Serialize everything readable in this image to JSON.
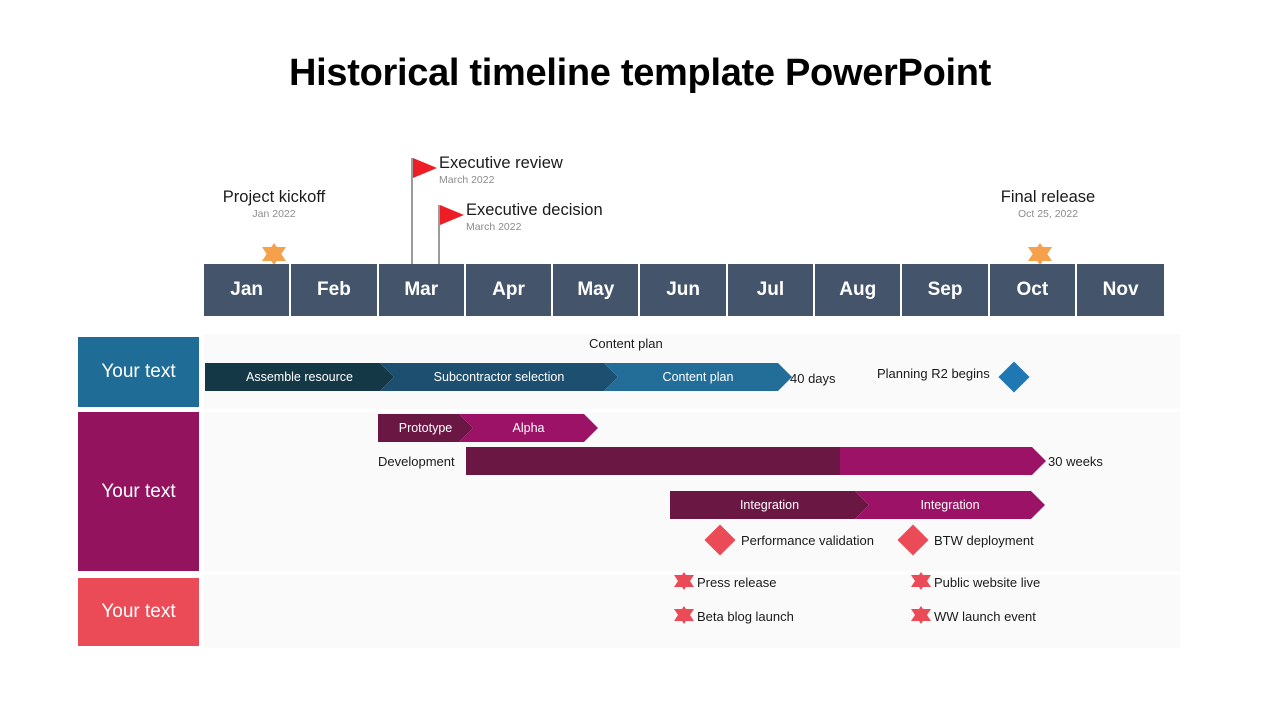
{
  "title": "Historical timeline template PowerPoint",
  "colors": {
    "axis": "#44546a",
    "lane_blue": "#1f6d96",
    "lane_magenta": "#93135e",
    "lane_red": "#ea4b57",
    "chevron_blue_dark": "#153847",
    "chevron_blue_mid": "#1d5070",
    "chevron_blue_light": "#226e99",
    "chevron_plum_dark": "#6b1744",
    "chevron_magenta": "#9c1266",
    "diamond_blue": "#1f77b4",
    "diamond_red": "#ea4b57",
    "star_orange": "#f5a04a",
    "star_red": "#ea4b57",
    "flag_red": "#ee1c25"
  },
  "axis": {
    "months": [
      "Jan",
      "Feb",
      "Mar",
      "Apr",
      "May",
      "Jun",
      "Jul",
      "Aug",
      "Sep",
      "Oct",
      "Nov"
    ]
  },
  "callouts": [
    {
      "name": "project-kickoff",
      "title": "Project kickoff",
      "date": "Jan 2022",
      "marker": "star",
      "marker_color": "star_orange"
    },
    {
      "name": "executive-review",
      "title": "Executive review",
      "date": "March 2022",
      "marker": "flag",
      "marker_color": "flag_red"
    },
    {
      "name": "executive-decision",
      "title": "Executive decision",
      "date": "March 2022",
      "marker": "flag",
      "marker_color": "flag_red"
    },
    {
      "name": "final-release",
      "title": "Final release",
      "date": "Oct 25, 2022",
      "marker": "star",
      "marker_color": "star_orange"
    }
  ],
  "lanes": [
    {
      "name": "lane-1",
      "label": "Your text",
      "color": "lane_blue",
      "top_caption": "Content  plan",
      "chevrons": [
        {
          "label": "Assemble resource",
          "color": "chevron_blue_dark"
        },
        {
          "label": "Subcontractor  selection",
          "color": "chevron_blue_mid"
        },
        {
          "label": "Content  plan",
          "color": "chevron_blue_light"
        }
      ],
      "duration": "40 days",
      "milestones": [
        {
          "label": "Planning  R2 begins",
          "shape": "diamond",
          "color": "diamond_blue"
        }
      ]
    },
    {
      "name": "lane-2",
      "label": "Your text",
      "color": "lane_magenta",
      "chevrons_top": [
        {
          "label": "Prototype",
          "color": "chevron_plum_dark"
        },
        {
          "label": "Alpha",
          "color": "chevron_magenta"
        }
      ],
      "development_caption": "Development",
      "development_duration": "30 weeks",
      "chevrons_mid": [
        {
          "label": "Integration",
          "color": "chevron_plum_dark"
        },
        {
          "label": "Integration",
          "color": "chevron_magenta"
        }
      ],
      "milestones": [
        {
          "label": "Performance  validation",
          "shape": "diamond",
          "color": "diamond_red"
        },
        {
          "label": "BTW deployment",
          "shape": "diamond",
          "color": "diamond_red"
        }
      ]
    },
    {
      "name": "lane-3",
      "label": "Your text",
      "color": "lane_red",
      "milestones": [
        {
          "label": "Press release",
          "shape": "star",
          "color": "star_red"
        },
        {
          "label": "Public  website live",
          "shape": "star",
          "color": "star_red"
        },
        {
          "label": "Beta blog launch",
          "shape": "star",
          "color": "star_red"
        },
        {
          "label": "WW launch  event",
          "shape": "star",
          "color": "star_red"
        }
      ]
    }
  ]
}
